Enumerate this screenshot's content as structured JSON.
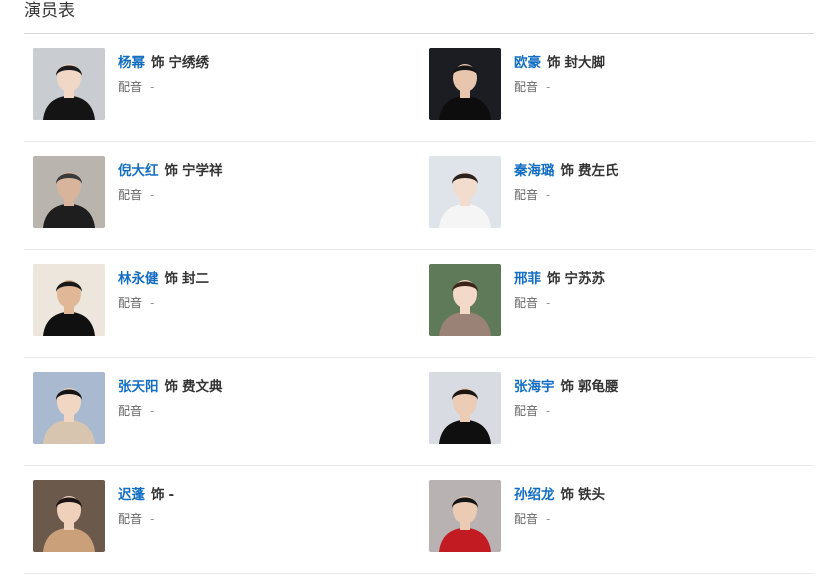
{
  "title": "演员表",
  "cast": [
    {
      "actor": "杨幂",
      "role_prefix": "饰",
      "role": "宁绣绣",
      "dub_label": "配音",
      "dub_value": "-",
      "bg": "#c9ccd0",
      "skin": "#f0d7c6",
      "hair": "#1c1a1a",
      "cloth": "#141414"
    },
    {
      "actor": "欧豪",
      "role_prefix": "饰",
      "role": "封大脚",
      "dub_label": "配音",
      "dub_value": "-",
      "bg": "#1b1d22",
      "skin": "#e8c6ae",
      "hair": "#151515",
      "cloth": "#0d0d0d"
    },
    {
      "actor": "倪大红",
      "role_prefix": "饰",
      "role": "宁学祥",
      "dub_label": "配音",
      "dub_value": "-",
      "bg": "#b9b4ad",
      "skin": "#d9b49c",
      "hair": "#3a3a3a",
      "cloth": "#1e1e1e"
    },
    {
      "actor": "秦海璐",
      "role_prefix": "饰",
      "role": "费左氏",
      "dub_label": "配音",
      "dub_value": "-",
      "bg": "#dfe4ea",
      "skin": "#f2dccd",
      "hair": "#2a211c",
      "cloth": "#f5f5f5"
    },
    {
      "actor": "林永健",
      "role_prefix": "饰",
      "role": "封二",
      "dub_label": "配音",
      "dub_value": "-",
      "bg": "#ece6dc",
      "skin": "#e0b898",
      "hair": "#181818",
      "cloth": "#101010"
    },
    {
      "actor": "邢菲",
      "role_prefix": "饰",
      "role": "宁苏苏",
      "dub_label": "配音",
      "dub_value": "-",
      "bg": "#5e7a58",
      "skin": "#f3d9c8",
      "hair": "#3b2418",
      "cloth": "#9a8276"
    },
    {
      "actor": "张天阳",
      "role_prefix": "饰",
      "role": "费文典",
      "dub_label": "配音",
      "dub_value": "-",
      "bg": "#a9b9cf",
      "skin": "#f1d6c3",
      "hair": "#141414",
      "cloth": "#d8c5b0"
    },
    {
      "actor": "张海宇",
      "role_prefix": "饰",
      "role": "郭龟腰",
      "dub_label": "配音",
      "dub_value": "-",
      "bg": "#d8dbe2",
      "skin": "#ecccb5",
      "hair": "#1b1510",
      "cloth": "#0f0f0f"
    },
    {
      "actor": "迟蓬",
      "role_prefix": "饰",
      "role": "-",
      "dub_label": "配音",
      "dub_value": "-",
      "bg": "#6b5a4c",
      "skin": "#eed0bb",
      "hair": "#1c1513",
      "cloth": "#c9a07a"
    },
    {
      "actor": "孙绍龙",
      "role_prefix": "饰",
      "role": "铁头",
      "dub_label": "配音",
      "dub_value": "-",
      "bg": "#b8b2b2",
      "skin": "#eccbb5",
      "hair": "#141414",
      "cloth": "#c21b22"
    }
  ]
}
